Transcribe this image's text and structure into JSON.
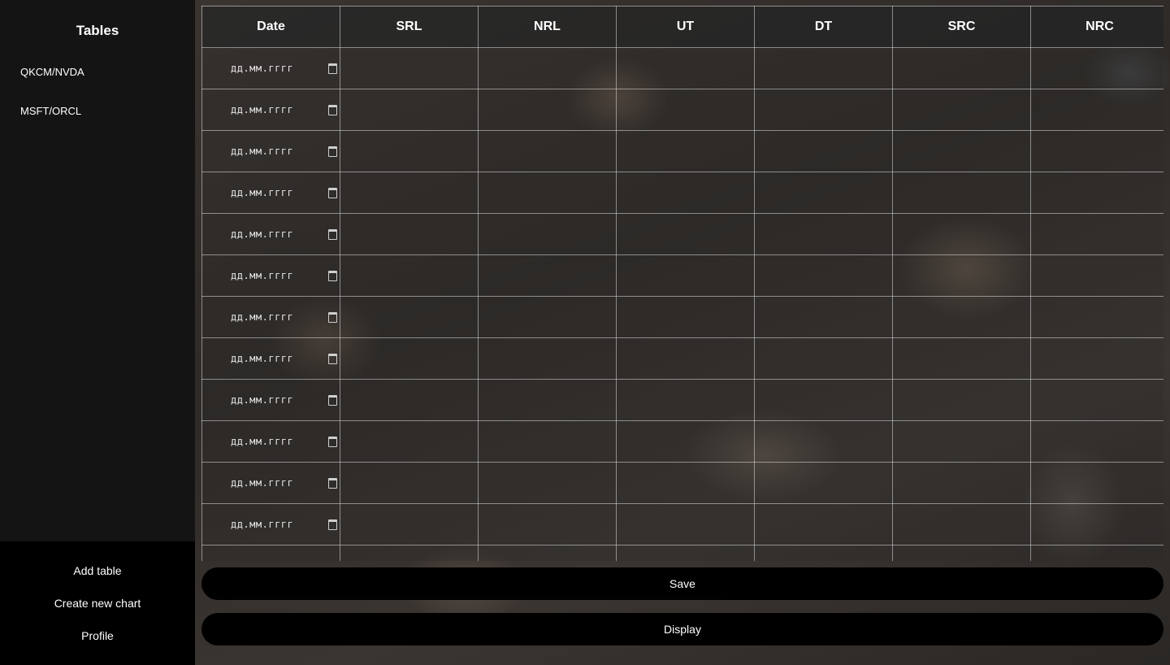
{
  "sidebar": {
    "title": "Tables",
    "items": [
      {
        "label": "QKCM/NVDA"
      },
      {
        "label": "MSFT/ORCL"
      }
    ],
    "bottom": {
      "add_table": "Add table",
      "create_chart": "Create new chart",
      "profile": "Profile"
    }
  },
  "table": {
    "columns": [
      "Date",
      "SRL",
      "NRL",
      "UT",
      "DT",
      "SRC",
      "NRC"
    ],
    "date_placeholder": "дд.мм.гггг"
  },
  "actions": {
    "save": "Save",
    "display": "Display"
  },
  "icons": {
    "calendar": "calendar-icon"
  }
}
